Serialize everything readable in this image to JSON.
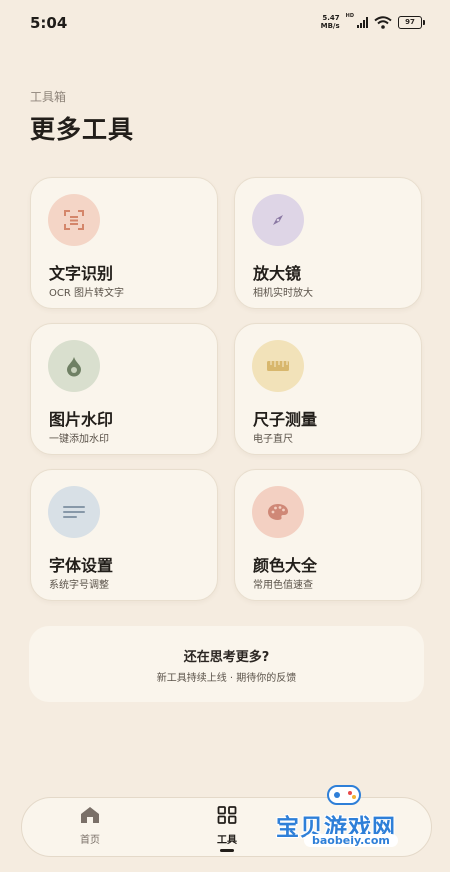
{
  "status": {
    "time": "5:04",
    "net_speed_value": "5.47",
    "net_speed_unit": "MB/s",
    "network_type": "HD",
    "battery": "97"
  },
  "header": {
    "subtitle": "工具箱",
    "title": "更多工具"
  },
  "tools": [
    {
      "title": "文字识别",
      "desc": "OCR 图片转文字",
      "icon": "text-scan-icon",
      "color": "#f4d5c6"
    },
    {
      "title": "放大镜",
      "desc": "相机实时放大",
      "icon": "compass-icon",
      "color": "#ded5e6"
    },
    {
      "title": "图片水印",
      "desc": "一键添加水印",
      "icon": "water-drop-icon",
      "color": "#d9dfce"
    },
    {
      "title": "尺子测量",
      "desc": "电子直尺",
      "icon": "ruler-icon",
      "color": "#f2e2b9"
    },
    {
      "title": "字体设置",
      "desc": "系统字号调整",
      "icon": "text-lines-icon",
      "color": "#d8e0e6"
    },
    {
      "title": "颜色大全",
      "desc": "常用色值速查",
      "icon": "palette-icon",
      "color": "#f3d0c2"
    }
  ],
  "more": {
    "title": "还在思考更多?",
    "desc": "新工具持续上线 · 期待你的反馈"
  },
  "nav": {
    "items": [
      {
        "label": "首页",
        "icon": "home-icon",
        "active": false
      },
      {
        "label": "工具",
        "icon": "grid-icon",
        "active": true
      }
    ]
  },
  "watermark": {
    "text": "宝贝游戏网",
    "url": "baobeiy.com"
  }
}
